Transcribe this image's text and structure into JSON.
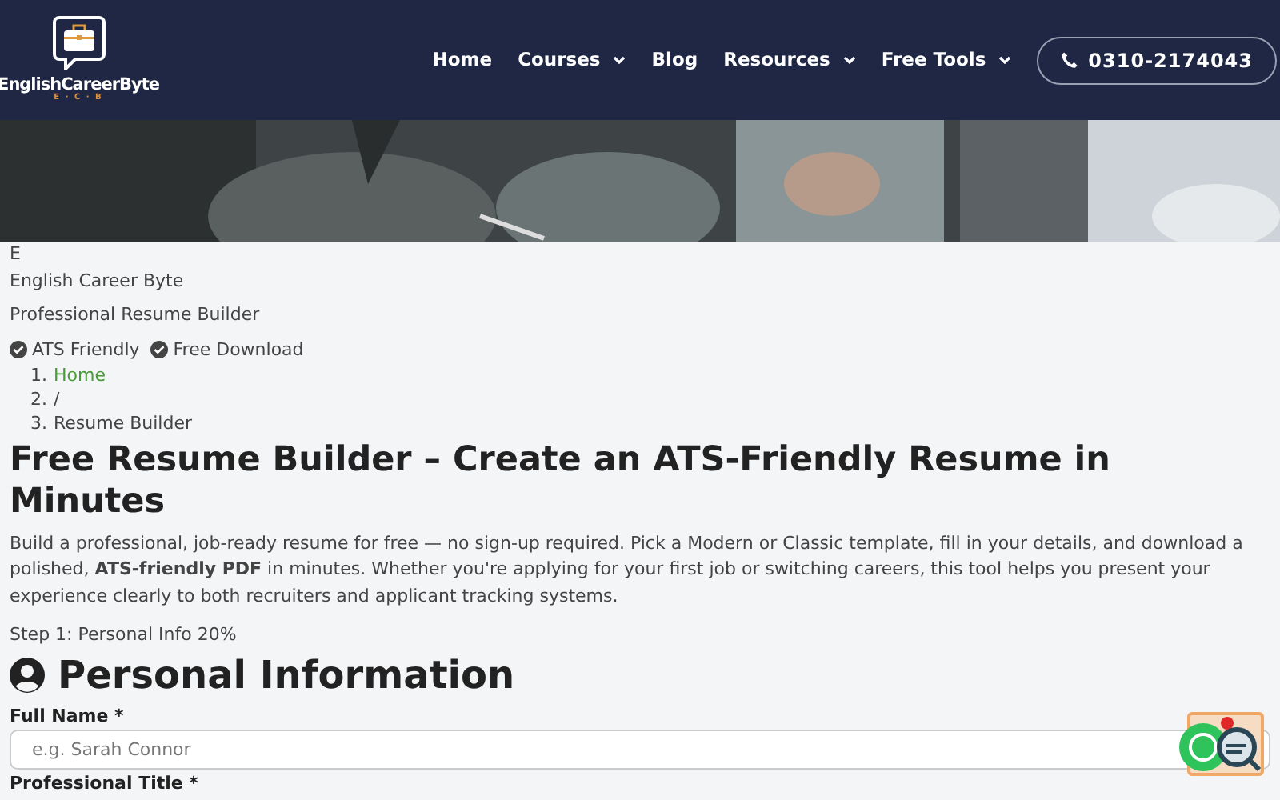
{
  "header": {
    "logo_text": "EnglishCareerByte",
    "logo_sub": "E · C · B",
    "nav": [
      {
        "label": "Home",
        "dropdown": false
      },
      {
        "label": "Courses",
        "dropdown": true
      },
      {
        "label": "Blog",
        "dropdown": false
      },
      {
        "label": "Resources",
        "dropdown": true
      },
      {
        "label": "Free Tools",
        "dropdown": true
      }
    ],
    "phone": "0310-2174043"
  },
  "hero": {
    "kind": "picture"
  },
  "brand_letter": "E",
  "brand_name": "English Career Byte",
  "tagline": "Professional Resume Builder",
  "features": [
    "ATS Friendly",
    "Free Download"
  ],
  "breadcrumb": [
    {
      "marker": "1.",
      "label": "Home",
      "link": true
    },
    {
      "marker": "2.",
      "label": "/",
      "link": false
    },
    {
      "marker": "3.",
      "label": "Resume Builder",
      "link": false
    }
  ],
  "title": "Free Resume Builder – Create an ATS-Friendly Resume in Minutes",
  "intro": "Build a professional, job-ready resume for free — no sign-up required. Pick a Modern or Classic template, fill in your details, and download a polished, **ATS-friendly PDF** in minutes. Whether you're applying for your first job or switching careers, this tool helps you present your experience clearly to both recruiters and applicant tracking systems.",
  "step": "Step 1: Personal Info 20%",
  "section_title": "Personal Information",
  "fields": [
    {
      "label": "Full Name *",
      "placeholder": "e.g. Sarah Connor"
    },
    {
      "label": "Professional Title *"
    }
  ]
}
